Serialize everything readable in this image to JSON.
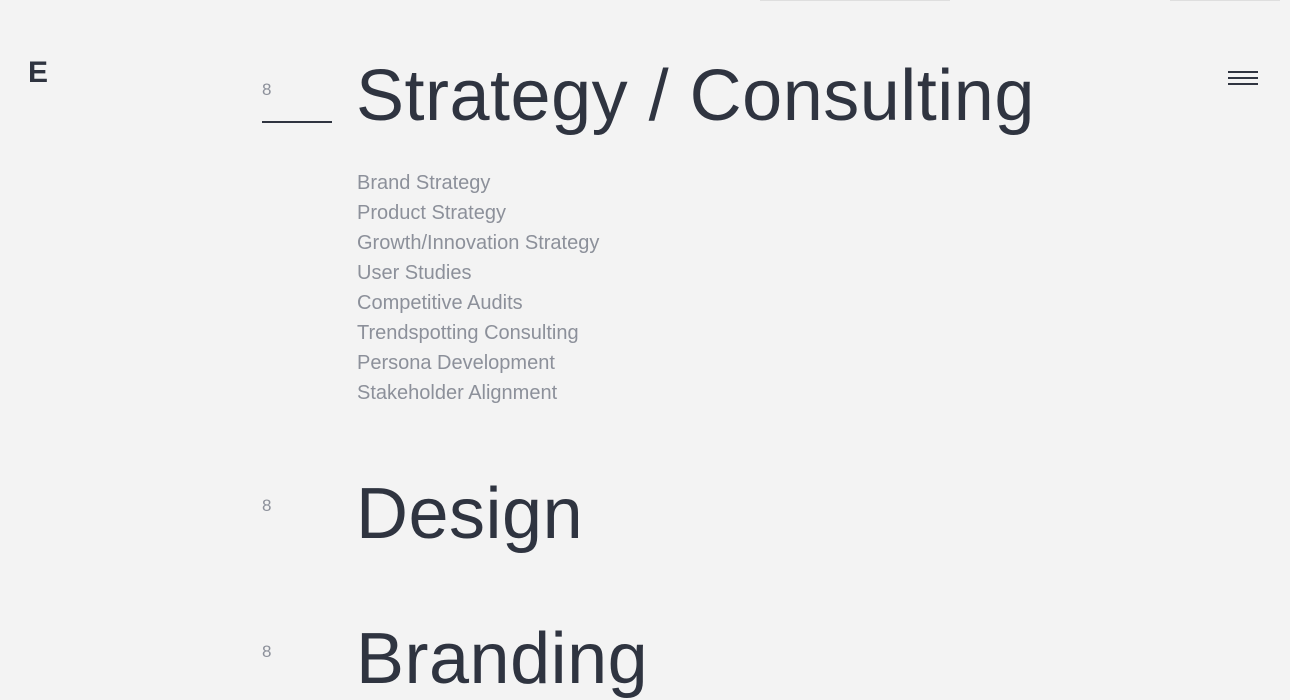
{
  "header": {
    "logo_text": "E",
    "menu_icon": "hamburger-icon"
  },
  "sections": [
    {
      "number": "8",
      "title": "Strategy / Consulting",
      "expanded": true,
      "items": [
        "Brand Strategy",
        "Product Strategy",
        "Growth/Innovation Strategy",
        "User Studies",
        "Competitive Audits",
        "Trendspotting Consulting",
        "Persona Development",
        "Stakeholder Alignment"
      ]
    },
    {
      "number": "8",
      "title": "Design",
      "expanded": false
    },
    {
      "number": "8",
      "title": "Branding",
      "expanded": false
    }
  ],
  "colors": {
    "background": "#f3f3f3",
    "heading": "#2f3440",
    "muted": "#8c909a"
  }
}
